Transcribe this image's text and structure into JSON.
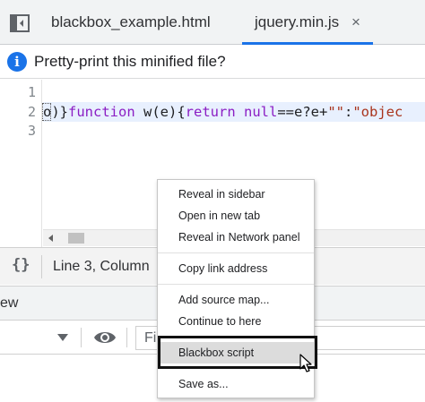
{
  "tabs": [
    {
      "label": "blackbox_example.html"
    },
    {
      "label": "jquery.min.js",
      "close": "×"
    }
  ],
  "infobar": {
    "icon": "info-icon",
    "text": "Pretty-print this minified file?"
  },
  "editor": {
    "line_numbers": [
      "1",
      "2",
      "3"
    ],
    "code_line_2": {
      "t1": "o)}",
      "t2": "function",
      "t3": " w(e){",
      "t4": "return",
      "t5": " ",
      "t6": "null",
      "t7": "==e?e+",
      "t8": "\"\"",
      "t9": ":",
      "t10": "\"objec"
    }
  },
  "statusbar": {
    "icon": "curly-braces-icon",
    "text": "Line 3, Column"
  },
  "drawer": {
    "tab_text": "ew"
  },
  "console_toolbar": {
    "filter_placeholder": "Fi"
  },
  "context_menu": {
    "items": [
      "Reveal in sidebar",
      "Open in new tab",
      "Reveal in Network panel",
      "Copy link address",
      "Add source map...",
      "Continue to here",
      "Blackbox script",
      "Save as..."
    ],
    "highlighted": "Blackbox script"
  },
  "colors": {
    "accent": "#1a73e8",
    "keyword": "#8b1ec4",
    "string": "#a9341c"
  }
}
